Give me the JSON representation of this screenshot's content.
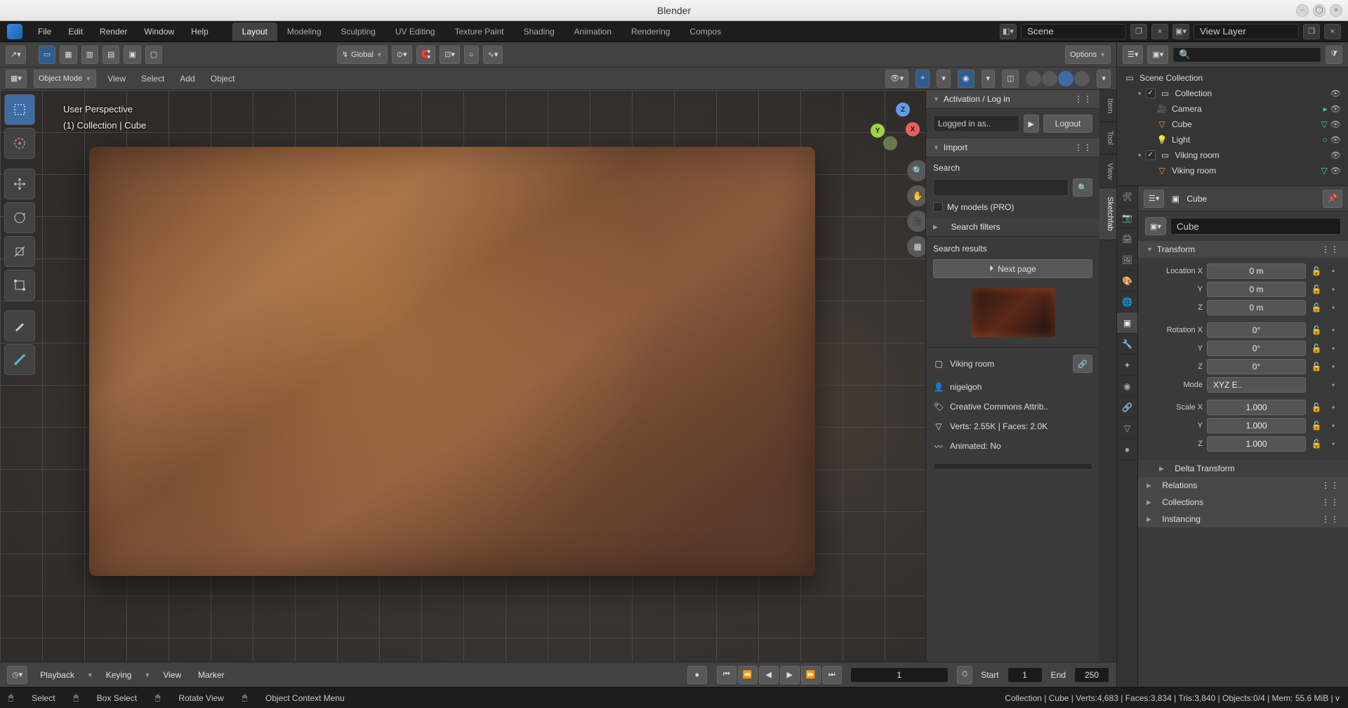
{
  "window": {
    "title": "Blender"
  },
  "menubar": {
    "items": [
      "File",
      "Edit",
      "Render",
      "Window",
      "Help"
    ]
  },
  "workspaces": {
    "tabs": [
      "Layout",
      "Modeling",
      "Sculpting",
      "UV Editing",
      "Texture Paint",
      "Shading",
      "Animation",
      "Rendering",
      "Compos"
    ],
    "active": "Layout"
  },
  "scene": {
    "label": "Scene",
    "viewlayer": "View Layer"
  },
  "toolbar": {
    "orientation": "Global",
    "options": "Options"
  },
  "viewport_header": {
    "mode": "Object Mode",
    "menus": [
      "View",
      "Select",
      "Add",
      "Object"
    ]
  },
  "viewport_overlay": {
    "line1": "User Perspective",
    "line2": "(1) Collection | Cube"
  },
  "right_tabs": [
    "Item",
    "Tool",
    "View",
    "Sketchfab"
  ],
  "sketchfab": {
    "activation_title": "Activation / Log in",
    "logged_in": "Logged in as..",
    "logout": "Logout",
    "import_title": "Import",
    "search_label": "Search",
    "my_models": "My models (PRO)",
    "filters": "Search filters",
    "results_title": "Search results",
    "next_page": "Next page",
    "model_name": "Viking room",
    "author": "nigelgoh",
    "license": "Creative Commons Attrib..",
    "geom": "Verts: 2.55K  |  Faces: 2.0K",
    "animated": "Animated: No"
  },
  "outliner": {
    "root": "Scene Collection",
    "items": [
      {
        "name": "Collection",
        "type": "collection",
        "depth": 1,
        "expanded": true
      },
      {
        "name": "Camera",
        "type": "camera",
        "depth": 2
      },
      {
        "name": "Cube",
        "type": "mesh",
        "depth": 2
      },
      {
        "name": "Light",
        "type": "light",
        "depth": 2
      },
      {
        "name": "Viking room",
        "type": "collection",
        "depth": 1,
        "expanded": true
      },
      {
        "name": "Viking room",
        "type": "mesh",
        "depth": 2
      }
    ]
  },
  "props": {
    "pin_object": "Cube",
    "object_name": "Cube",
    "transform_title": "Transform",
    "location": {
      "x": "0 m",
      "y": "0 m",
      "z": "0 m"
    },
    "rotation": {
      "x": "0°",
      "y": "0°",
      "z": "0°"
    },
    "mode_label": "Mode",
    "mode_value": "XYZ E..",
    "scale": {
      "x": "1.000",
      "y": "1.000",
      "z": "1.000"
    },
    "labels": {
      "locx": "Location X",
      "y": "Y",
      "z": "Z",
      "rotx": "Rotation X",
      "scalex": "Scale X"
    },
    "sections": [
      "Delta Transform",
      "Relations",
      "Collections",
      "Instancing"
    ]
  },
  "timeline": {
    "menus": [
      "Playback",
      "Keying",
      "View",
      "Marker"
    ],
    "current": "1",
    "start_label": "Start",
    "start": "1",
    "end_label": "End",
    "end": "250"
  },
  "statusbar": {
    "select": "Select",
    "boxselect": "Box Select",
    "rotate": "Rotate View",
    "context": "Object Context Menu",
    "right": "Collection | Cube | Verts:4,683 | Faces:3,834 | Tris:3,840 | Objects:0/4 | Mem: 55.6 MiB | v"
  }
}
